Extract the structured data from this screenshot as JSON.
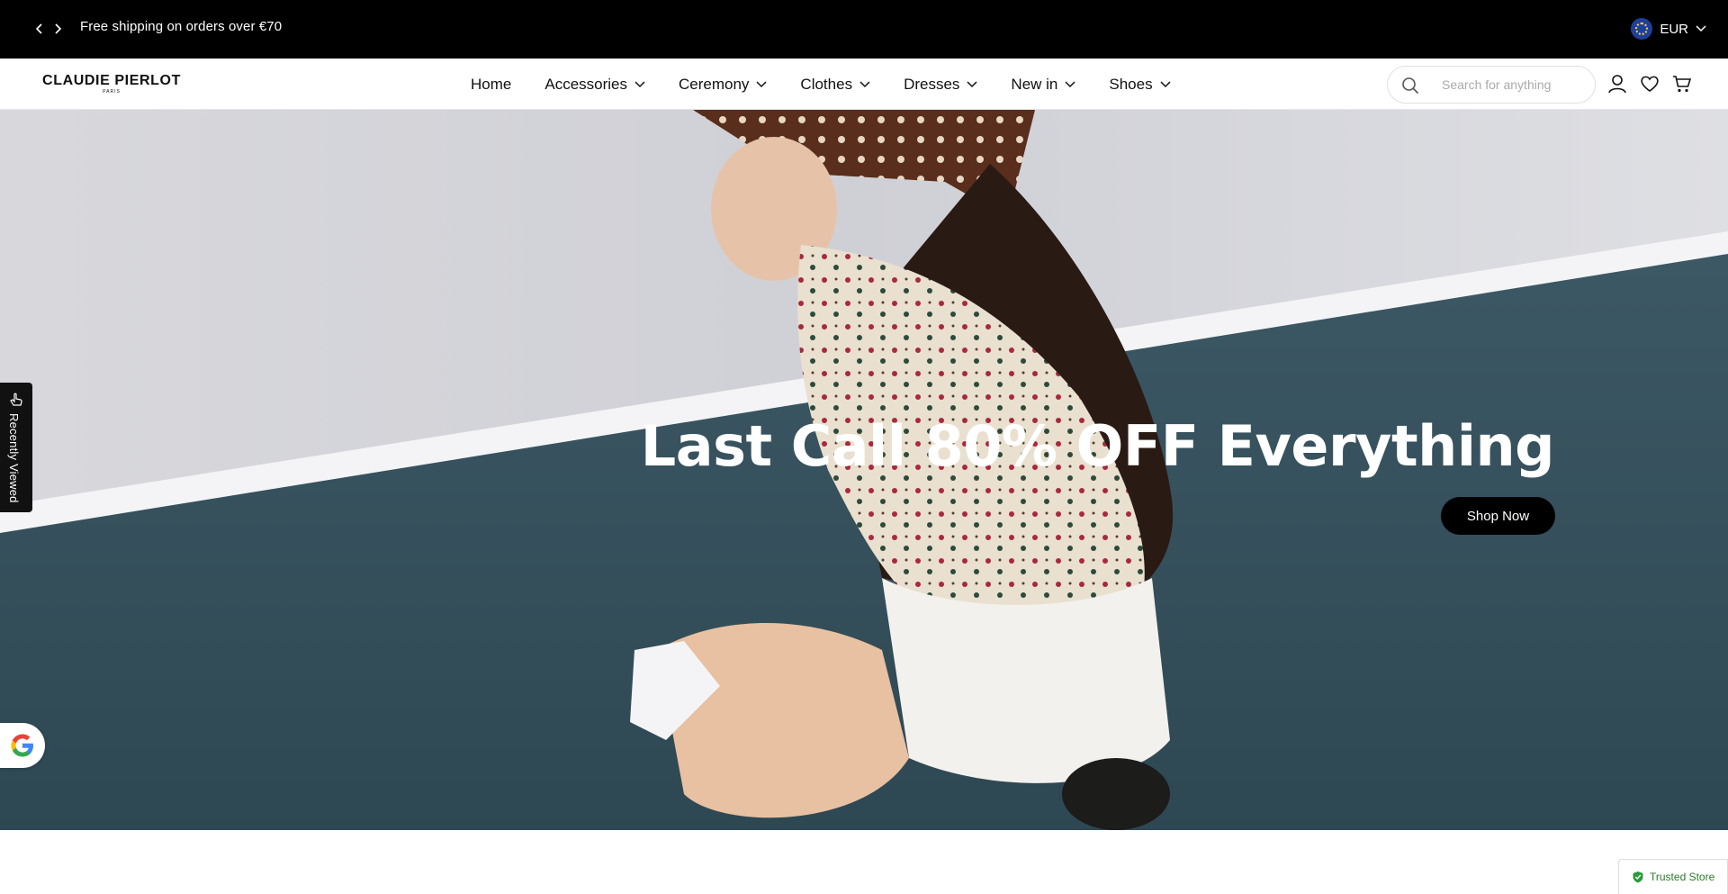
{
  "announcement": {
    "message": "Free shipping on orders over €70",
    "currency": "EUR"
  },
  "header": {
    "logo_brand": "CLAUDIE PIERLOT",
    "logo_sub": "PARIS",
    "nav": [
      {
        "label": "Home"
      },
      {
        "label": "Accessories"
      },
      {
        "label": "Ceremony"
      },
      {
        "label": "Clothes"
      },
      {
        "label": "Dresses"
      },
      {
        "label": "New in"
      },
      {
        "label": "Shoes"
      }
    ],
    "search_placeholder": "Search for anything"
  },
  "hero": {
    "title": "Last Call 80% OFF Everything",
    "button": "Shop Now"
  },
  "widgets": {
    "recently_viewed": "Recently Viewed",
    "trusted_store": "Trusted Store"
  },
  "colors": {
    "announcement_bg": "#000000",
    "accent": "#000000",
    "hero_text": "#ffffff"
  },
  "icons": {
    "search": "search-icon",
    "account": "user-icon",
    "wishlist": "heart-icon",
    "cart": "cart-icon"
  }
}
